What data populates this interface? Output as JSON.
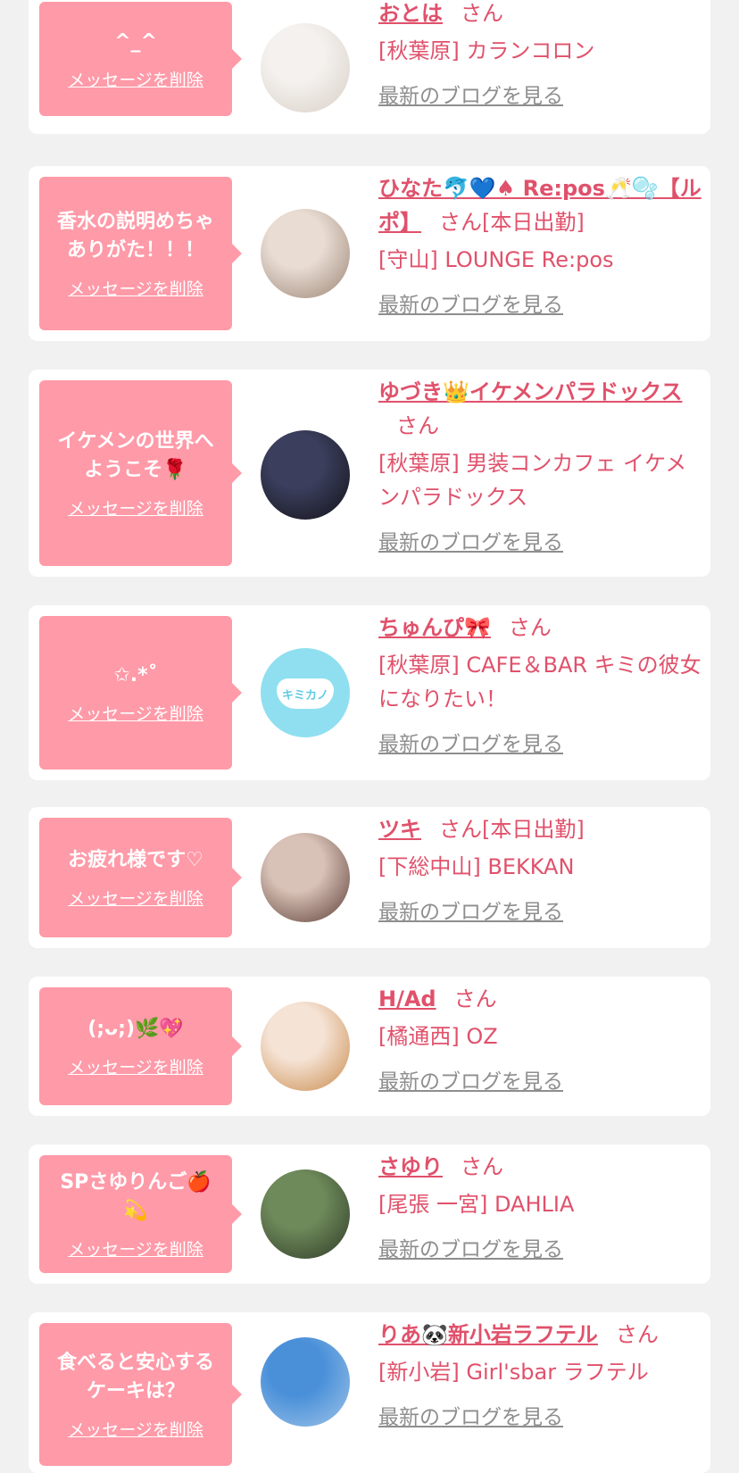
{
  "messages": [
    {
      "bubble_text": "^_^",
      "delete_label": "メッセージを削除",
      "name": "おとは",
      "honorific": "さん",
      "status": "",
      "shop": "[秋葉原] カランコロン",
      "blog_label": "最新のブログを見る",
      "avatar_colors": [
        "#f4f1ee",
        "#d9cfc6"
      ]
    },
    {
      "bubble_text": "香水の説明めちゃ\nありがた！！！",
      "delete_label": "メッセージを削除",
      "name": "ひなた🐬💙♠ Re:pos🥂🫧【ルポ】",
      "honorific": "さん",
      "status": "[本日出勤]",
      "shop": "[守山] LOUNGE Re:pos",
      "blog_label": "最新のブログを見る",
      "avatar_colors": [
        "#e8dcd3",
        "#9c8474"
      ]
    },
    {
      "bubble_text": "イケメンの世界へ\nようこそ🌹",
      "delete_label": "メッセージを削除",
      "name": "ゆづき👑イケメンパラドックス",
      "honorific": "さん",
      "status": "",
      "shop": "[秋葉原] 男装コンカフェ イケメンパラドックス",
      "blog_label": "最新のブログを見る",
      "avatar_colors": [
        "#3b3e5c",
        "#111218"
      ]
    },
    {
      "bubble_text": "✩.*˚",
      "delete_label": "メッセージを削除",
      "name": "ちゅんぴ🎀",
      "honorific": "さん",
      "status": "",
      "shop": "[秋葉原] CAFE＆BAR キミの彼女になりたい！",
      "blog_label": "最新のブログを見る",
      "avatar_colors": [
        "#8fdff0",
        "#5fcbe4"
      ],
      "avatar_text": "キミカノ"
    },
    {
      "bubble_text": "お疲れ様です♡",
      "delete_label": "メッセージを削除",
      "name": "ツキ",
      "honorific": "さん",
      "status": "[本日出勤]",
      "shop": "[下総中山] BEKKAN",
      "blog_label": "最新のブログを見る",
      "avatar_colors": [
        "#d8c1b6",
        "#5a3d35"
      ]
    },
    {
      "bubble_text": "(;ᴗ;)🌿💖",
      "delete_label": "メッセージを削除",
      "name": "H/Ad",
      "honorific": "さん",
      "status": "",
      "shop": "[橘通西] OZ",
      "blog_label": "最新のブログを見る",
      "avatar_colors": [
        "#f5e3d5",
        "#c98a4b"
      ]
    },
    {
      "bubble_text": "SPさゆりんご🍎\n💫",
      "delete_label": "メッセージを削除",
      "name": "さゆり",
      "honorific": "さん",
      "status": "",
      "shop": "[尾張 一宮] DAHLIA",
      "blog_label": "最新のブログを見る",
      "avatar_colors": [
        "#6e8a5a",
        "#2f3a27"
      ]
    },
    {
      "bubble_text": "食べると安心する\nケーキは？",
      "delete_label": "メッセージを削除",
      "name": "りあ🐼新小岩ラフテル",
      "honorific": "さん",
      "status": "",
      "shop": "[新小岩] Girl'sbar ラフテル",
      "blog_label": "最新のブログを見る",
      "avatar_colors": [
        "#4a90d9",
        "#9fc4e8"
      ]
    }
  ],
  "colors": {
    "bubble": "#ff9aa8",
    "name": "#e0516b",
    "blog_link": "#8e8e8e",
    "background": "#f1f1f1"
  }
}
